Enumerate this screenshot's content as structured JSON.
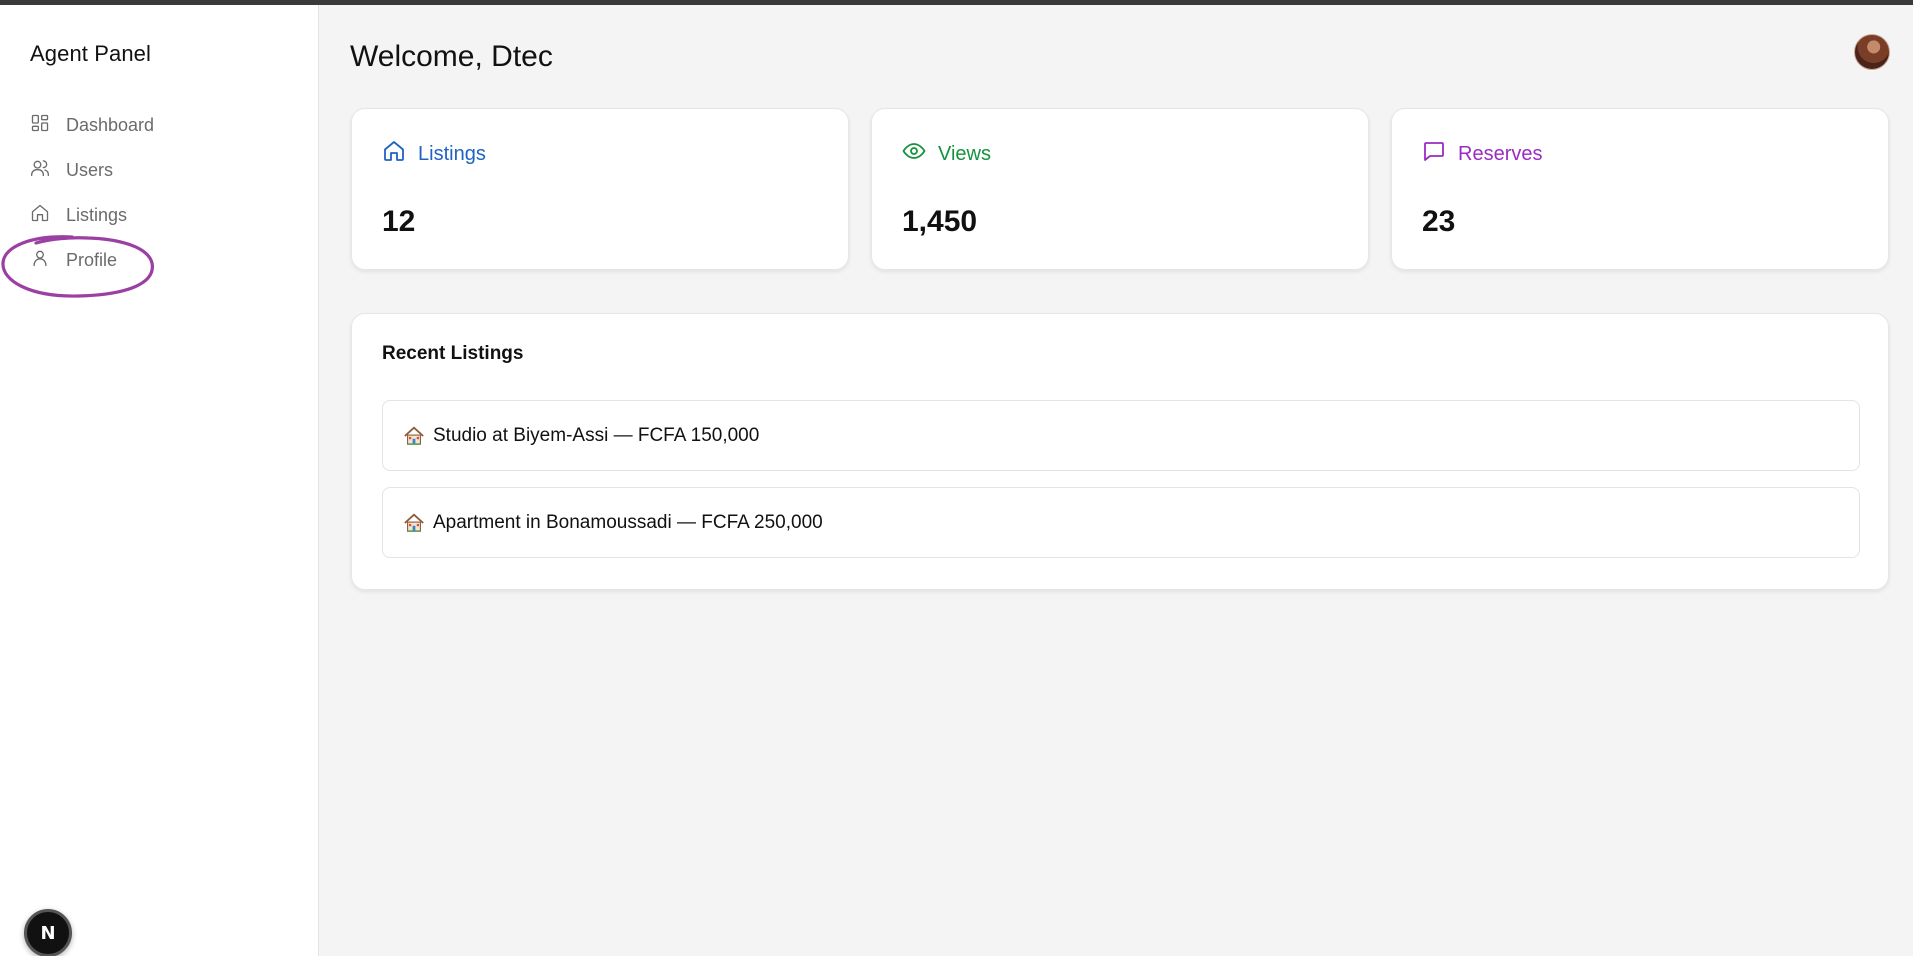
{
  "sidebar": {
    "title": "Agent Panel",
    "items": [
      {
        "label": "Dashboard",
        "icon": "dashboard-grid-icon"
      },
      {
        "label": "Users",
        "icon": "users-icon"
      },
      {
        "label": "Listings",
        "icon": "home-icon"
      },
      {
        "label": "Profile",
        "icon": "user-icon"
      }
    ],
    "badge_letter": "N"
  },
  "header": {
    "welcome": "Welcome, Dtec",
    "avatar_icon": "avatar"
  },
  "stats": [
    {
      "label": "Listings",
      "value": "12",
      "icon": "home-icon",
      "color": "#1f63c2"
    },
    {
      "label": "Views",
      "value": "1,450",
      "icon": "eye-icon",
      "color": "#15923f"
    },
    {
      "label": "Reserves",
      "value": "23",
      "icon": "chat-bubble-icon",
      "color": "#9b2bc2"
    }
  ],
  "recent": {
    "title": "Recent Listings",
    "items": [
      {
        "text": "Studio at Biyem-Assi — FCFA 150,000",
        "icon": "house-emoji-icon"
      },
      {
        "text": "Apartment in Bonamoussadi — FCFA 250,000",
        "icon": "house-emoji-icon"
      }
    ]
  },
  "annotation": {
    "color": "#9b3fa3"
  }
}
